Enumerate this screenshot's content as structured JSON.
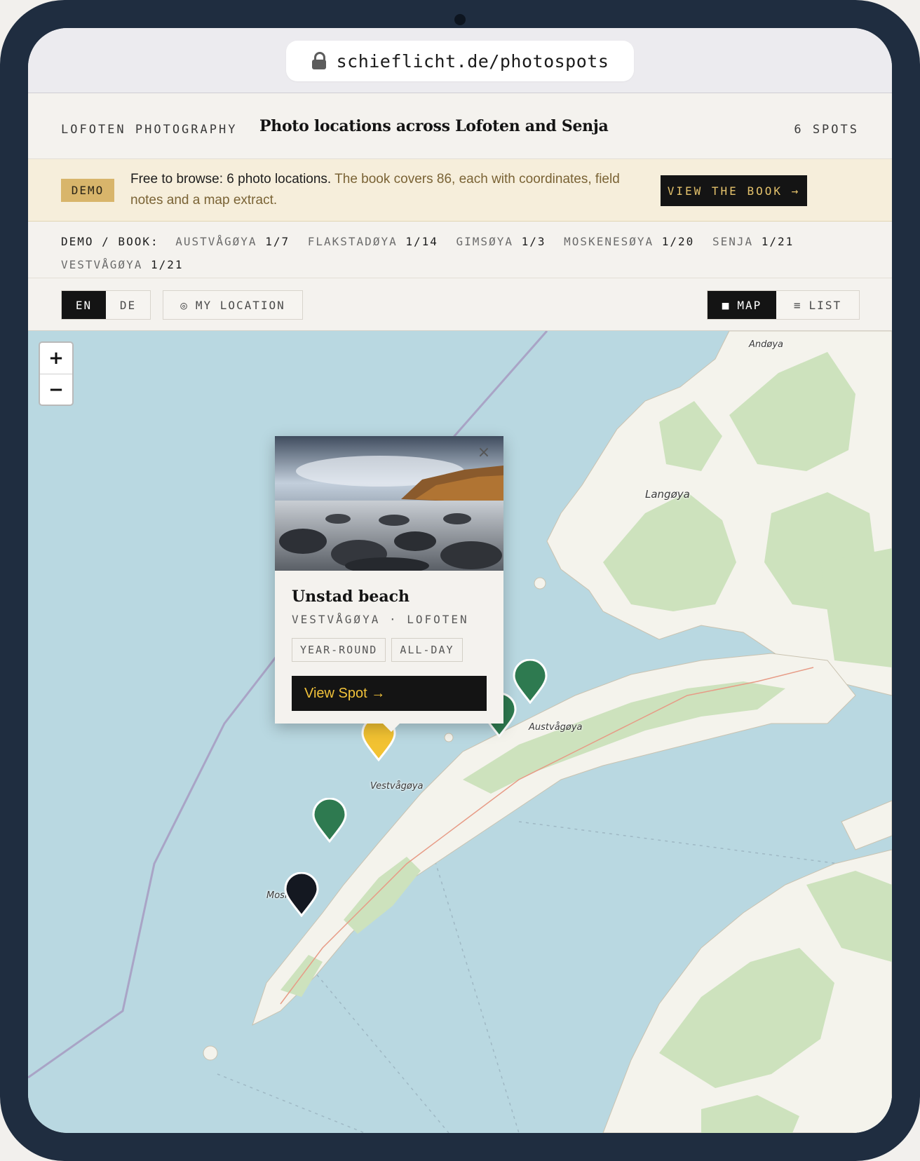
{
  "browser": {
    "url": "schieflicht.de/photospots"
  },
  "header": {
    "brand": "LOFOTEN PHOTOGRAPHY",
    "headline": "Photo locations across Lofoten and Senja",
    "spots_count": "6 SPOTS"
  },
  "banner": {
    "badge": "DEMO",
    "text_strong": "Free to browse: 6 photo locations.",
    "text_rest": " The book covers 86, each with coordinates, field notes and a map extract.",
    "button": "VIEW THE BOOK →"
  },
  "counts": {
    "prefix": "DEMO / BOOK:",
    "items": [
      {
        "name": "AUSTVÅGØYA",
        "count": "1/7"
      },
      {
        "name": "FLAKSTADØYA",
        "count": "1/14"
      },
      {
        "name": "GIMSØYA",
        "count": "1/3"
      },
      {
        "name": "MOSKENESØYA",
        "count": "1/20"
      },
      {
        "name": "SENJA",
        "count": "1/21"
      },
      {
        "name": "VESTVÅGØYA",
        "count": "1/21"
      }
    ]
  },
  "toolbar": {
    "lang_en": "EN",
    "lang_de": "DE",
    "my_location": "MY LOCATION",
    "my_location_icon": "◎",
    "view_map": "MAP",
    "view_map_icon": "■",
    "view_list": "LIST",
    "view_list_icon": "≡"
  },
  "map": {
    "zoom_in": "+",
    "zoom_out": "−",
    "labels": {
      "andoya": "Andøya",
      "langoya": "Langøya",
      "austvagoya": "Austvågøya",
      "vestvagoya": "Vestvågøya",
      "moskenes": "Mosk"
    },
    "colors": {
      "water": "#b9d8e1",
      "land": "#f5f5ef",
      "forest": "#cfe4bf",
      "marker_green": "#2e7a50",
      "marker_selected": "#f2c232",
      "marker_dark": "#141821"
    }
  },
  "popup": {
    "close": "×",
    "title": "Unstad beach",
    "region": "VESTVÅGØYA · LOFOTEN",
    "tags": [
      "YEAR-ROUND",
      "ALL-DAY"
    ],
    "button": "View Spot →"
  }
}
